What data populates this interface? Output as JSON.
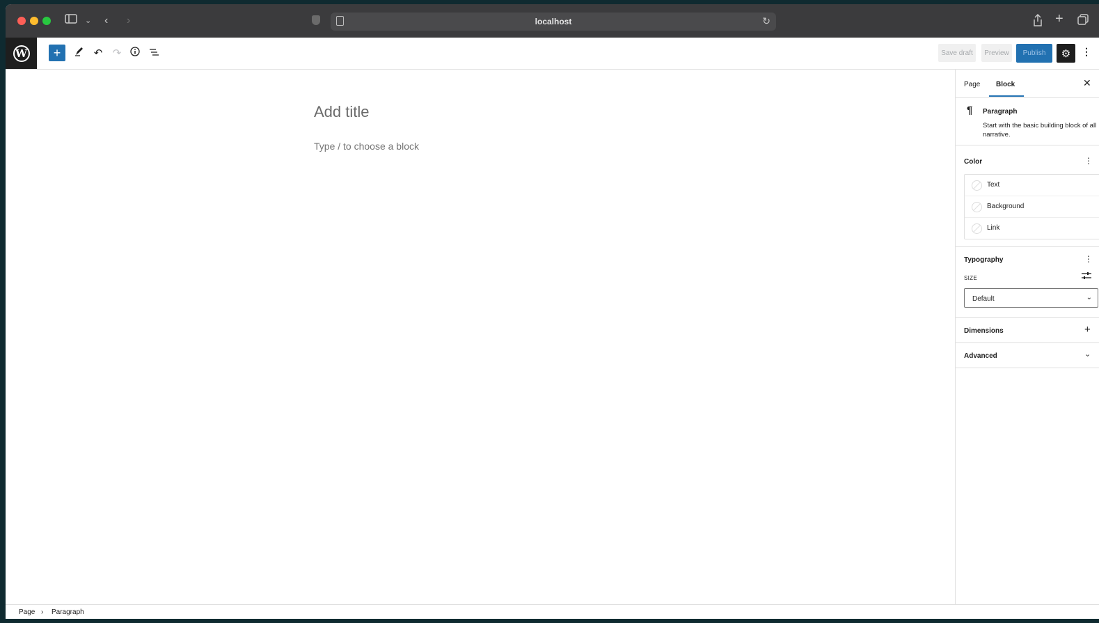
{
  "browser": {
    "address": "localhost"
  },
  "toolbar": {
    "inserter_icon": "plus-icon",
    "save_draft_label": "Save draft",
    "preview_label": "Preview",
    "publish_label": "Publish",
    "accent_color": "#2271b1"
  },
  "editor": {
    "title_placeholder": "Add title",
    "block_placeholder": "Type / to choose a block"
  },
  "sidebar": {
    "tabs": [
      {
        "label": "Page"
      },
      {
        "label": "Block"
      }
    ],
    "block_card": {
      "title": "Paragraph",
      "description": "Start with the basic building block of all narrative."
    },
    "color": {
      "title": "Color",
      "items": [
        {
          "label": "Text"
        },
        {
          "label": "Background"
        },
        {
          "label": "Link"
        }
      ]
    },
    "typography": {
      "title": "Typography",
      "size_label": "SIZE",
      "size_value": "Default"
    },
    "dimensions": {
      "title": "Dimensions"
    },
    "advanced": {
      "title": "Advanced"
    }
  },
  "breadcrumb": {
    "items": [
      "Page",
      "Paragraph"
    ]
  }
}
